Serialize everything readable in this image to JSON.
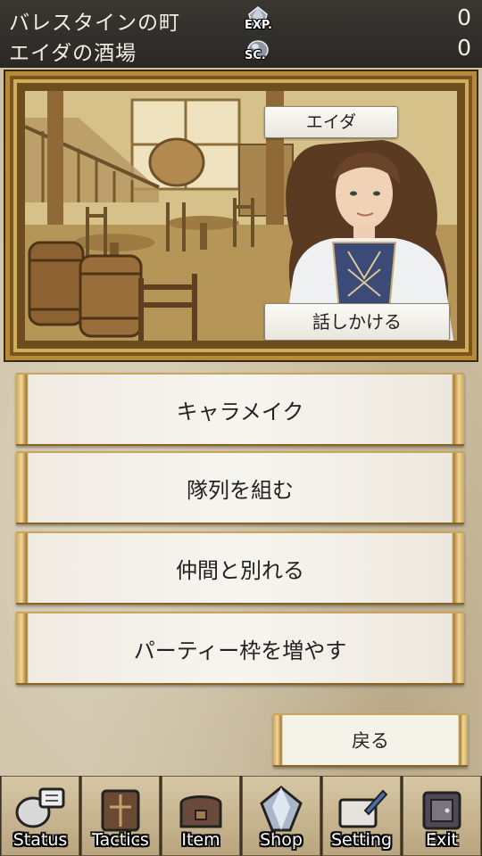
{
  "header": {
    "town": "バレスタインの町",
    "place": "エイダの酒場",
    "exp_label": "EXP.",
    "exp_value": "0",
    "sc_label": "SC.",
    "sc_value": "0"
  },
  "scene": {
    "npc_name": "エイダ",
    "talk_label": "話しかける"
  },
  "menu": [
    {
      "label": "キャラメイク"
    },
    {
      "label": "隊列を組む"
    },
    {
      "label": "仲間と別れる"
    },
    {
      "label": "パーティー枠を増やす"
    }
  ],
  "back_label": "戻る",
  "nav": [
    {
      "label": "Status",
      "icon": "status-icon"
    },
    {
      "label": "Tactics",
      "icon": "tactics-icon"
    },
    {
      "label": "Item",
      "icon": "item-icon"
    },
    {
      "label": "Shop",
      "icon": "shop-icon"
    },
    {
      "label": "Setting",
      "icon": "setting-icon"
    },
    {
      "label": "Exit",
      "icon": "exit-icon"
    }
  ]
}
